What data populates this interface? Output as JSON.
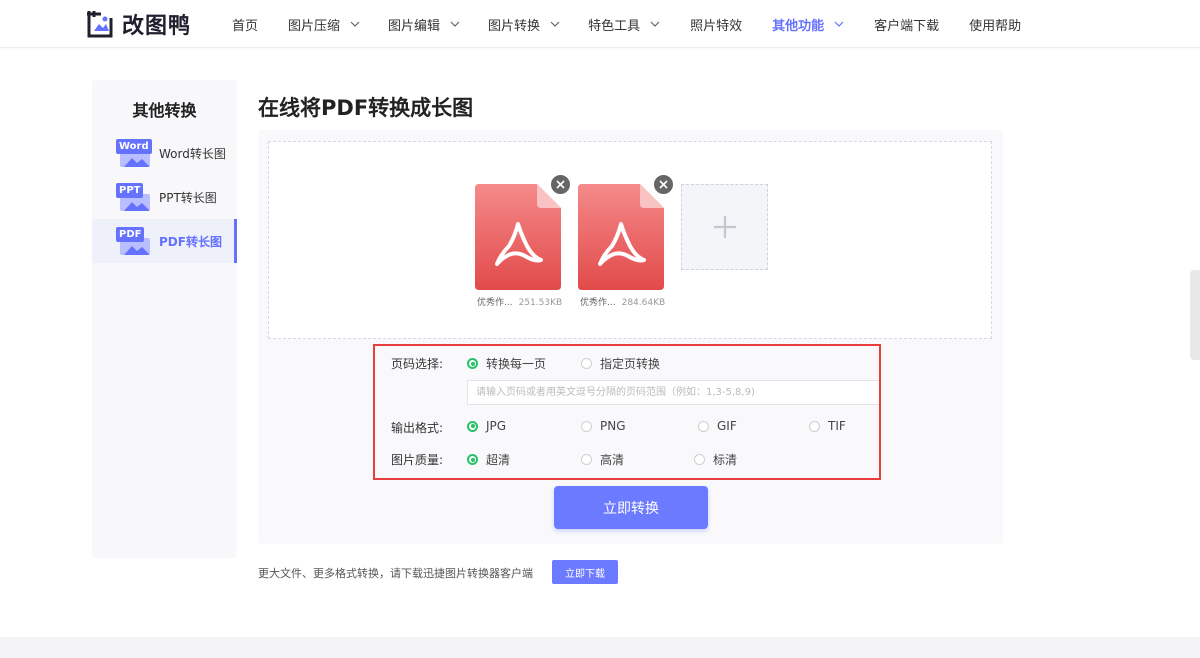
{
  "header": {
    "logo_text": "改图鸭",
    "nav": [
      {
        "label": "首页",
        "dropdown": false,
        "active": false
      },
      {
        "label": "图片压缩",
        "dropdown": true,
        "active": false
      },
      {
        "label": "图片编辑",
        "dropdown": true,
        "active": false
      },
      {
        "label": "图片转换",
        "dropdown": true,
        "active": false
      },
      {
        "label": "特色工具",
        "dropdown": true,
        "active": false
      },
      {
        "label": "照片特效",
        "dropdown": false,
        "active": false
      },
      {
        "label": "其他功能",
        "dropdown": true,
        "active": true
      },
      {
        "label": "客户端下载",
        "dropdown": false,
        "active": false
      },
      {
        "label": "使用帮助",
        "dropdown": false,
        "active": false
      }
    ]
  },
  "sidebar": {
    "title": "其他转换",
    "items": [
      {
        "tag": "Word",
        "label": "Word转长图",
        "active": false
      },
      {
        "tag": "PPT",
        "label": "PPT转长图",
        "active": false
      },
      {
        "tag": "PDF",
        "label": "PDF转长图",
        "active": true
      }
    ]
  },
  "main": {
    "title": "在线将PDF转换成长图",
    "files": [
      {
        "name": "优秀作...",
        "size": "251.53KB"
      },
      {
        "name": "优秀作...",
        "size": "284.64KB"
      }
    ],
    "options": {
      "page_select": {
        "label": "页码选择:",
        "choices": [
          "转换每一页",
          "指定页转换"
        ],
        "selected": 0,
        "input_placeholder": "请输入页码或者用英文逗号分隔的页码范围（例如：1,3-5,8,9)"
      },
      "format": {
        "label": "输出格式:",
        "choices": [
          "JPG",
          "PNG",
          "GIF",
          "TIF"
        ],
        "selected": 0
      },
      "quality": {
        "label": "图片质量:",
        "choices": [
          "超清",
          "高清",
          "标清"
        ],
        "selected": 0
      }
    },
    "convert_button": "立即转换"
  },
  "footer": {
    "note": "更大文件、更多格式转换，请下载迅捷图片转换器客户端",
    "download_button": "立即下载"
  },
  "colors": {
    "accent": "#6571ff",
    "button": "#6b7aff",
    "radio_selected": "#27c16a",
    "highlight_border": "#e83e3e",
    "pdf_icon": "#e85656"
  }
}
